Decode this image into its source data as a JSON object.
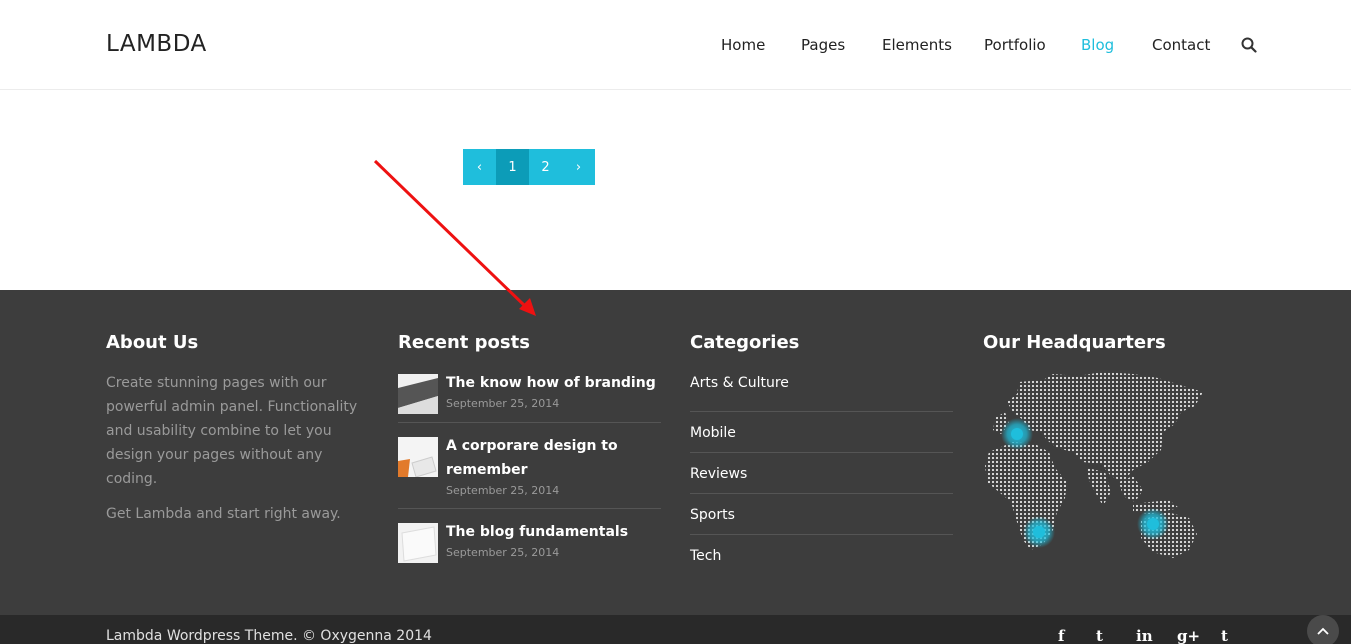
{
  "header": {
    "logo": "LAMBDA",
    "nav": [
      {
        "label": "Home"
      },
      {
        "label": "Pages"
      },
      {
        "label": "Elements"
      },
      {
        "label": "Portfolio"
      },
      {
        "label": "Blog",
        "active": true
      },
      {
        "label": "Contact"
      }
    ],
    "search_icon": "search-icon"
  },
  "pagination": {
    "prev": "‹",
    "pages": [
      "1",
      "2"
    ],
    "current": "1",
    "next": "›"
  },
  "footer": {
    "about": {
      "title": "About Us",
      "p1": "Create stunning pages with our powerful admin panel. Functionality and usability combine to let you design your pages without any coding.",
      "p2": "Get Lambda and start right away."
    },
    "recent": {
      "title": "Recent posts",
      "posts": [
        {
          "title": "The know how of branding",
          "date": "September 25, 2014"
        },
        {
          "title": "A corporare design to remember",
          "date": "September 25, 2014"
        },
        {
          "title": "The blog fundamentals",
          "date": "September 25, 2014"
        }
      ]
    },
    "categories": {
      "title": "Categories",
      "items": [
        "Arts & Culture",
        "Mobile",
        "Reviews",
        "Sports",
        "Tech"
      ]
    },
    "hq": {
      "title": "Our Headquarters"
    }
  },
  "bottom": {
    "copyright": "Lambda Wordpress Theme. © Oxygenna 2014",
    "social": [
      "f",
      "t",
      "in",
      "g+",
      "t"
    ],
    "social_icons": [
      "facebook-icon",
      "twitter-icon",
      "linkedin-icon",
      "google-plus-icon",
      "tumblr-icon"
    ],
    "totop_icon": "chevron-up-icon"
  },
  "colors": {
    "accent": "#1fbedc",
    "accent_dark": "#0c9cb8",
    "footer_bg": "#3d3d3d",
    "bottom_bg": "#292929",
    "annotation_arrow": "#ee1111"
  }
}
